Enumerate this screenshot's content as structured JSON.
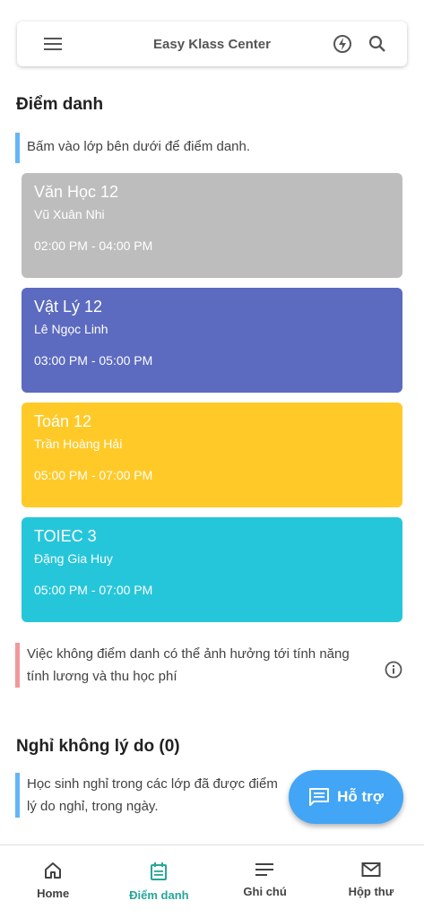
{
  "header": {
    "title": "Easy Klass Center"
  },
  "attendance": {
    "title": "Điểm danh",
    "hint": "Bấm vào lớp bên dưới để điểm danh.",
    "classes": [
      {
        "name": "Văn Học 12",
        "teacher": "Vũ Xuân Nhi",
        "time": "02:00 PM - 04:00 PM",
        "color": "#bdbdbd"
      },
      {
        "name": "Vật Lý 12",
        "teacher": "Lê Ngọc Linh",
        "time": "03:00 PM - 05:00 PM",
        "color": "#5c6bc0"
      },
      {
        "name": "Toán 12",
        "teacher": "Trần Hoàng Hải",
        "time": "05:00 PM - 07:00 PM",
        "color": "#ffca28"
      },
      {
        "name": "TOIEC 3",
        "teacher": "Đặng Gia Huy",
        "time": "05:00 PM - 07:00 PM",
        "color": "#26c6da"
      }
    ],
    "warning": "Việc không điểm danh có thể ảnh hưởng tới tính năng tính lương và thu học phí"
  },
  "absent": {
    "title": "Nghỉ không lý do (0)",
    "hint_line1": "Học sinh nghỉ trong các lớp đã được điểm",
    "hint_line2": "lý do nghỉ, trong ngày."
  },
  "fab": {
    "label": "Hỗ trợ"
  },
  "nav": {
    "items": [
      {
        "label": "Home"
      },
      {
        "label": "Điểm danh"
      },
      {
        "label": "Ghi chú"
      },
      {
        "label": "Hộp thư"
      }
    ]
  }
}
